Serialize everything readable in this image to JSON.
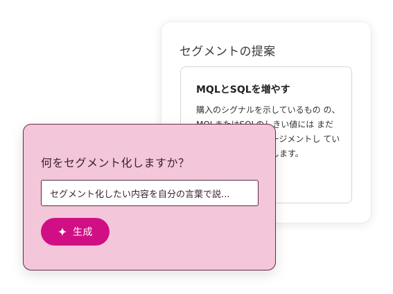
{
  "suggestions_card": {
    "title": "セグメントの提案",
    "item": {
      "title": "MQLとSQLを増やす",
      "body": "購入のシグナルを示しているもの の、MQLまたはSQLのしきい値には まだ達していないエンゲージメントし ているコンタクトを特定します。"
    }
  },
  "segment_panel": {
    "question": "何をセグメント化しますか？",
    "input_value": "セグメント化したい内容を自分の言葉で説...",
    "generate_button": {
      "label": "生成",
      "icon": "sparkle-icon",
      "color": "#d10f84"
    },
    "background_color": "#f3c6da"
  }
}
